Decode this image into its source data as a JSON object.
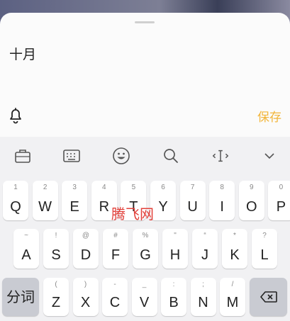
{
  "note": {
    "text": "十月"
  },
  "actions": {
    "save_label": "保存"
  },
  "toolbar": {
    "tools": [
      {
        "name": "briefcase-icon"
      },
      {
        "name": "keyboard-icon"
      },
      {
        "name": "emoji-icon"
      },
      {
        "name": "search-icon"
      },
      {
        "name": "text-cursor-icon"
      },
      {
        "name": "chevron-down-icon"
      }
    ]
  },
  "keyboard": {
    "row1": [
      {
        "hint": "1",
        "key": "Q"
      },
      {
        "hint": "2",
        "key": "W"
      },
      {
        "hint": "3",
        "key": "E"
      },
      {
        "hint": "4",
        "key": "R"
      },
      {
        "hint": "5",
        "key": "T"
      },
      {
        "hint": "6",
        "key": "Y"
      },
      {
        "hint": "7",
        "key": "U"
      },
      {
        "hint": "8",
        "key": "I"
      },
      {
        "hint": "9",
        "key": "O"
      },
      {
        "hint": "0",
        "key": "P"
      }
    ],
    "row2": [
      {
        "hint": "~",
        "key": "A"
      },
      {
        "hint": "!",
        "key": "S"
      },
      {
        "hint": "@",
        "key": "D"
      },
      {
        "hint": "#",
        "key": "F"
      },
      {
        "hint": "%",
        "key": "G"
      },
      {
        "hint": "\"",
        "key": "H"
      },
      {
        "hint": "“",
        "key": "J"
      },
      {
        "hint": "*",
        "key": "K"
      },
      {
        "hint": "?",
        "key": "L"
      }
    ],
    "row3": [
      {
        "hint": "(",
        "key": "Z"
      },
      {
        "hint": ")",
        "key": "X"
      },
      {
        "hint": "-",
        "key": "C"
      },
      {
        "hint": "_",
        "key": "V"
      },
      {
        "hint": ":",
        "key": "B"
      },
      {
        "hint": ";",
        "key": "N"
      },
      {
        "hint": "/",
        "key": "M"
      }
    ],
    "segment_label": "分词"
  },
  "watermark": "腾飞网",
  "colors": {
    "accent": "#f2b53a",
    "sheet": "#fbfbfb",
    "keyboard_bg": "#f1f1f3",
    "key": "#ffffff",
    "key_dark": "#c9cbd2"
  }
}
